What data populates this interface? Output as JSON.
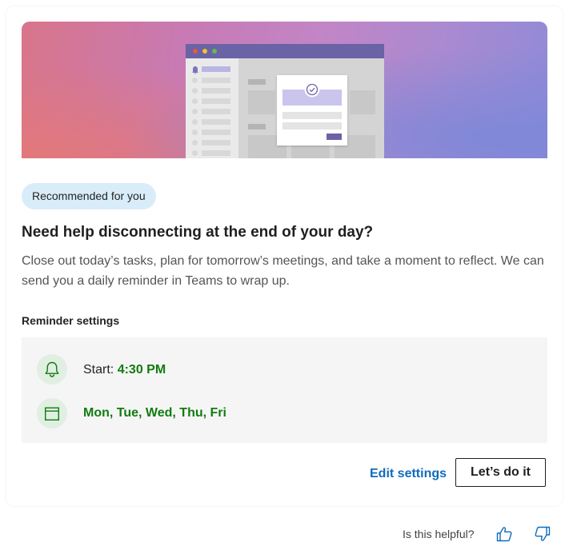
{
  "badge": {
    "label": "Recommended for you"
  },
  "heading": "Need help disconnecting at the end of your day?",
  "description": "Close out today’s tasks, plan for tomorrow’s meetings, and take a moment to reflect. We can send you a daily reminder in Teams to wrap up.",
  "reminder": {
    "section_label": "Reminder settings",
    "start_label": "Start:",
    "start_time": "4:30 PM",
    "days": "Mon, Tue, Wed, Thu, Fri"
  },
  "actions": {
    "edit_label": "Edit settings",
    "primary_label": "Let’s do it"
  },
  "feedback": {
    "question": "Is this helpful?"
  },
  "icons": {
    "reminder": "bell-icon",
    "days": "calendar-icon",
    "thumbs_up": "thumbs-up-icon",
    "thumbs_down": "thumbs-down-icon"
  },
  "colors": {
    "accent_green": "#107c10",
    "link_blue": "#0f6cbd",
    "badge_bg": "#d9ecf9",
    "settings_bg": "#f5f5f5"
  }
}
